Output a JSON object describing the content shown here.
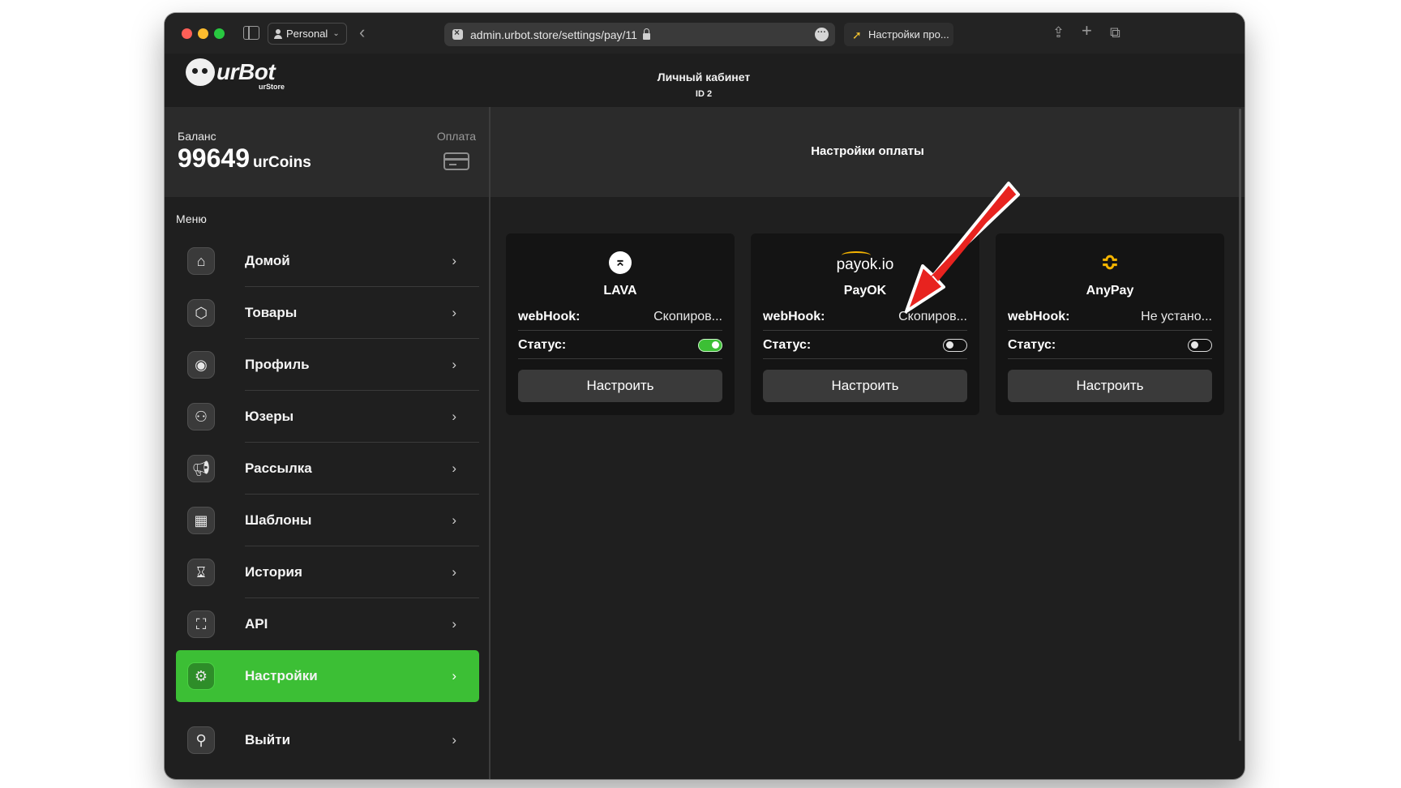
{
  "browser": {
    "profile": "Personal",
    "url": "admin.urbot.store/settings/pay/11",
    "tab_title": "Настройки про..."
  },
  "app": {
    "logo_text": "urBot",
    "logo_sub": "urStore",
    "header_title": "Личный кабинет",
    "header_id": "ID 2"
  },
  "balance": {
    "label": "Баланс",
    "value": "99649",
    "unit": "urCoins",
    "pay_label": "Оплата"
  },
  "page": {
    "title": "Настройки оплаты"
  },
  "menu": {
    "title": "Меню",
    "items": [
      {
        "label": "Домой",
        "icon": "home-icon",
        "active": false
      },
      {
        "label": "Товары",
        "icon": "box-icon",
        "active": false
      },
      {
        "label": "Профиль",
        "icon": "user-circle-icon",
        "active": false
      },
      {
        "label": "Юзеры",
        "icon": "users-icon",
        "active": false
      },
      {
        "label": "Рассылка",
        "icon": "megaphone-icon",
        "active": false
      },
      {
        "label": "Шаблоны",
        "icon": "grid-icon",
        "active": false
      },
      {
        "label": "История",
        "icon": "hourglass-icon",
        "active": false
      },
      {
        "label": "API",
        "icon": "chip-icon",
        "active": false
      },
      {
        "label": "Настройки",
        "icon": "gear-icon",
        "active": true
      },
      {
        "label": "Выйти",
        "icon": "logout-icon",
        "active": false
      }
    ]
  },
  "payment_providers": [
    {
      "logo": "lava-logo",
      "name": "LAVA",
      "webhook_label": "webHook:",
      "webhook_value": "Скопиров...",
      "status_label": "Статус:",
      "enabled": true,
      "button": "Настроить"
    },
    {
      "logo": "payok-logo",
      "logo_text": "payok.io",
      "name": "PayOK",
      "webhook_label": "webHook:",
      "webhook_value": "Скопиров...",
      "status_label": "Статус:",
      "enabled": false,
      "button": "Настроить"
    },
    {
      "logo": "anypay-logo",
      "name": "AnyPay",
      "webhook_label": "webHook:",
      "webhook_value": "Не устано...",
      "status_label": "Статус:",
      "enabled": false,
      "button": "Настроить"
    }
  ],
  "colors": {
    "accent_green": "#3cbf35",
    "annotation_red": "#e8231f",
    "anypay_yellow": "#f5b400"
  }
}
